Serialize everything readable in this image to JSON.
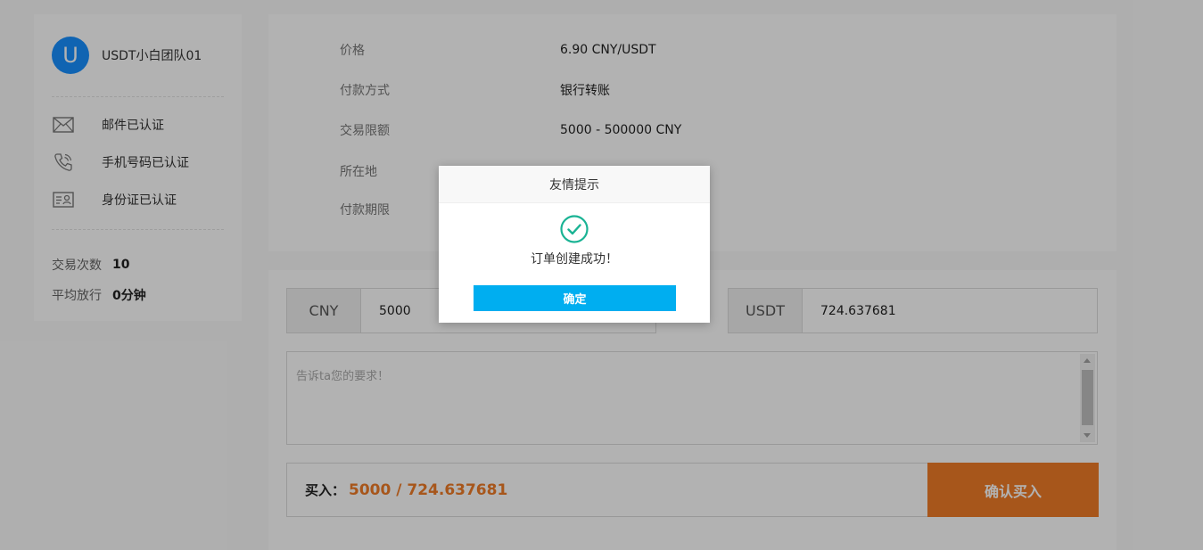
{
  "profile": {
    "avatar_letter": "U",
    "username": "USDT小白团队01",
    "verifications": [
      {
        "icon": "mail-icon",
        "label": "邮件已认证"
      },
      {
        "icon": "phone-icon",
        "label": "手机号码已认证"
      },
      {
        "icon": "id-card-icon",
        "label": "身份证已认证"
      }
    ],
    "stats": [
      {
        "label": "交易次数",
        "value": "10"
      },
      {
        "label": "平均放行",
        "value": "0分钟"
      }
    ]
  },
  "info": {
    "rows": [
      {
        "label": "价格",
        "value": "6.90 CNY/USDT"
      },
      {
        "label": "付款方式",
        "value": "银行转账"
      },
      {
        "label": "交易限额",
        "value": " 5000 - 500000 CNY"
      },
      {
        "label": "所在地",
        "value": ""
      },
      {
        "label": "付款期限",
        "value": ""
      }
    ]
  },
  "trade": {
    "cny_unit": "CNY",
    "cny_value": "5000",
    "usdt_unit": "USDT",
    "usdt_value": "724.637681",
    "remark_placeholder": "告诉ta您的要求！",
    "buy_label": "买入：",
    "buy_amount": "5000 / 724.637681",
    "confirm_label": "确认买入"
  },
  "dialog": {
    "title": "友情提示",
    "message": "订单创建成功！",
    "ok_label": "确定",
    "icon": "check-circle-icon"
  },
  "colors": {
    "accent_orange": "#f07c27",
    "accent_blue": "#00aef0",
    "avatar_blue": "#1890ff",
    "success_green": "#1ab394"
  }
}
